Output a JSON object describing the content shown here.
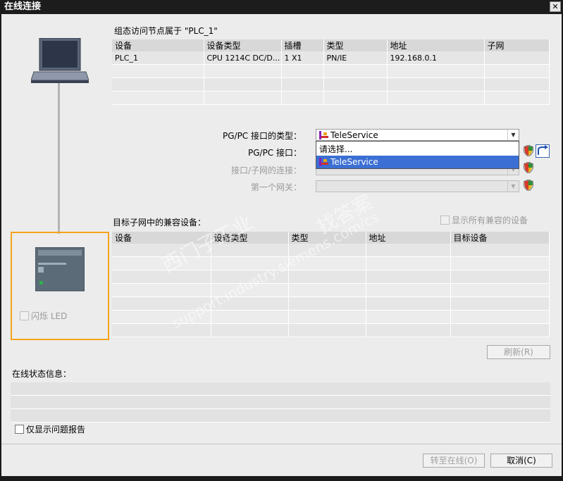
{
  "window": {
    "title": "在线连接",
    "close_glyph": "✕"
  },
  "top_section": {
    "title": "组态访问节点属于 \"PLC_1\"",
    "columns": [
      "设备",
      "设备类型",
      "插槽",
      "类型",
      "地址",
      "子网"
    ],
    "rows": [
      [
        "PLC_1",
        "CPU 1214C DC/D...",
        "1 X1",
        "PN/IE",
        "192.168.0.1",
        ""
      ],
      [
        "",
        "",
        "",
        "",
        "",
        ""
      ],
      [
        "",
        "",
        "",
        "",
        "",
        ""
      ],
      [
        "",
        "",
        "",
        "",
        "",
        ""
      ]
    ]
  },
  "interface": {
    "pgpc_type_label": "PG/PC 接口的类型：",
    "pgpc_type_value": "TeleService",
    "pgpc_iface_label": "PG/PC 接口：",
    "subnet_conn_label": "接口/子网的连接：",
    "first_gateway_label": "第一个网关：",
    "dropdown_options": [
      "请选择...",
      "TeleService"
    ],
    "dropdown_selected_index": 1
  },
  "target_section": {
    "title": "目标子网中的兼容设备：",
    "show_all_label": "显示所有兼容的设备",
    "columns": [
      "设备",
      "设备类型",
      "类型",
      "地址",
      "目标设备"
    ],
    "rows": [
      [
        "",
        "",
        "",
        "",
        ""
      ],
      [
        "",
        "",
        "",
        "",
        ""
      ],
      [
        "",
        "",
        "",
        "",
        ""
      ],
      [
        "",
        "",
        "",
        "",
        ""
      ],
      [
        "",
        "",
        "",
        "",
        ""
      ],
      [
        "",
        "",
        "",
        "",
        ""
      ],
      [
        "",
        "",
        "",
        "",
        ""
      ]
    ],
    "refresh_label": "刷新(R)"
  },
  "flash_led_label": "闪烁 LED",
  "status_section": {
    "title": "在线状态信息：",
    "only_problems_label": "仅显示问题报告"
  },
  "footer": {
    "go_online_label": "转至在线(O)",
    "cancel_label": "取消(C)"
  },
  "watermark": {
    "line1": "西门子工业",
    "line2": "support.industry.siemens.com/cs",
    "line3": "找答案"
  },
  "colors": {
    "highlight_border": "#f5a31a",
    "selection": "#3b6fd4"
  }
}
